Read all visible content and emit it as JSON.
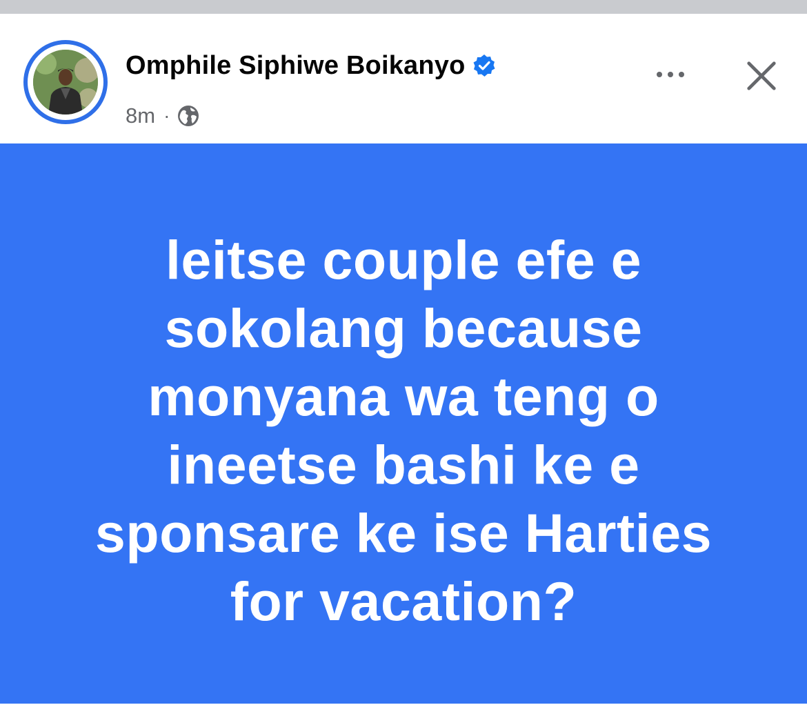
{
  "post": {
    "author_name": "Omphile Siphiwe Boikanyo",
    "verified": true,
    "timestamp": "8m",
    "separator": "·",
    "audience_icon": "globe-icon",
    "text": "leitse couple efe e\nsokolang because\nmonyana wa teng o\nineetse bashi ke e\nsponsare ke ise Harties\nfor vacation?",
    "background_color": "#3474f4",
    "text_color": "#ffffff"
  },
  "header": {
    "more_icon": "more-options-icon",
    "close_icon": "close-icon",
    "avatar_ring_color": "#2f6fe8",
    "verified_color": "#1877f2"
  }
}
